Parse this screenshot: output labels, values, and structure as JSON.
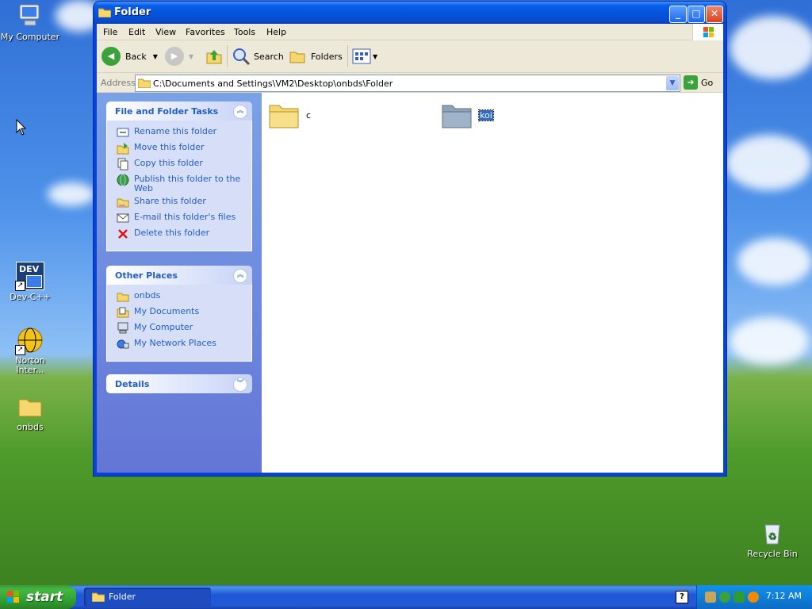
{
  "desktop": {
    "icons": [
      {
        "label": "My Computer"
      },
      {
        "label": "Dev-C++",
        "badge": "DEV"
      },
      {
        "label": "Norton Inter..."
      },
      {
        "label": "onbds"
      },
      {
        "label": "Recycle Bin"
      }
    ]
  },
  "window": {
    "title": "Folder",
    "controls": {
      "minimize": "_",
      "maximize": "□",
      "close": "✕"
    },
    "menu": [
      "File",
      "Edit",
      "View",
      "Favorites",
      "Tools",
      "Help"
    ],
    "toolbar": {
      "back": "Back",
      "search": "Search",
      "folders": "Folders"
    },
    "address": {
      "label": "Address",
      "value": "C:\\Documents and Settings\\VM2\\Desktop\\onbds\\Folder",
      "go": "Go"
    },
    "tasks_panel": {
      "title": "File and Folder Tasks",
      "items": [
        {
          "label": "Rename this folder",
          "icon": "rename-icon"
        },
        {
          "label": "Move this folder",
          "icon": "move-icon"
        },
        {
          "label": "Copy this folder",
          "icon": "copy-icon"
        },
        {
          "label": "Publish this folder to the Web",
          "icon": "publish-icon"
        },
        {
          "label": "Share this folder",
          "icon": "share-icon"
        },
        {
          "label": "E-mail this folder's files",
          "icon": "email-icon"
        },
        {
          "label": "Delete this folder",
          "icon": "delete-icon"
        }
      ]
    },
    "places_panel": {
      "title": "Other Places",
      "items": [
        {
          "label": "onbds",
          "icon": "folder-icon"
        },
        {
          "label": "My Documents",
          "icon": "documents-icon"
        },
        {
          "label": "My Computer",
          "icon": "computer-icon"
        },
        {
          "label": "My Network Places",
          "icon": "network-icon"
        }
      ]
    },
    "details_panel": {
      "title": "Details"
    },
    "files": [
      {
        "name": "c",
        "selected": false
      },
      {
        "name": "koi",
        "selected": true
      }
    ]
  },
  "taskbar": {
    "start": "start",
    "tasks": [
      {
        "label": "Folder"
      }
    ],
    "help": "?",
    "clock": "7:12 AM"
  },
  "colors": {
    "link": "#215dc6",
    "selection": "#316ac5",
    "titlebar": "#0553dd",
    "taskbar": "#2157d7"
  }
}
